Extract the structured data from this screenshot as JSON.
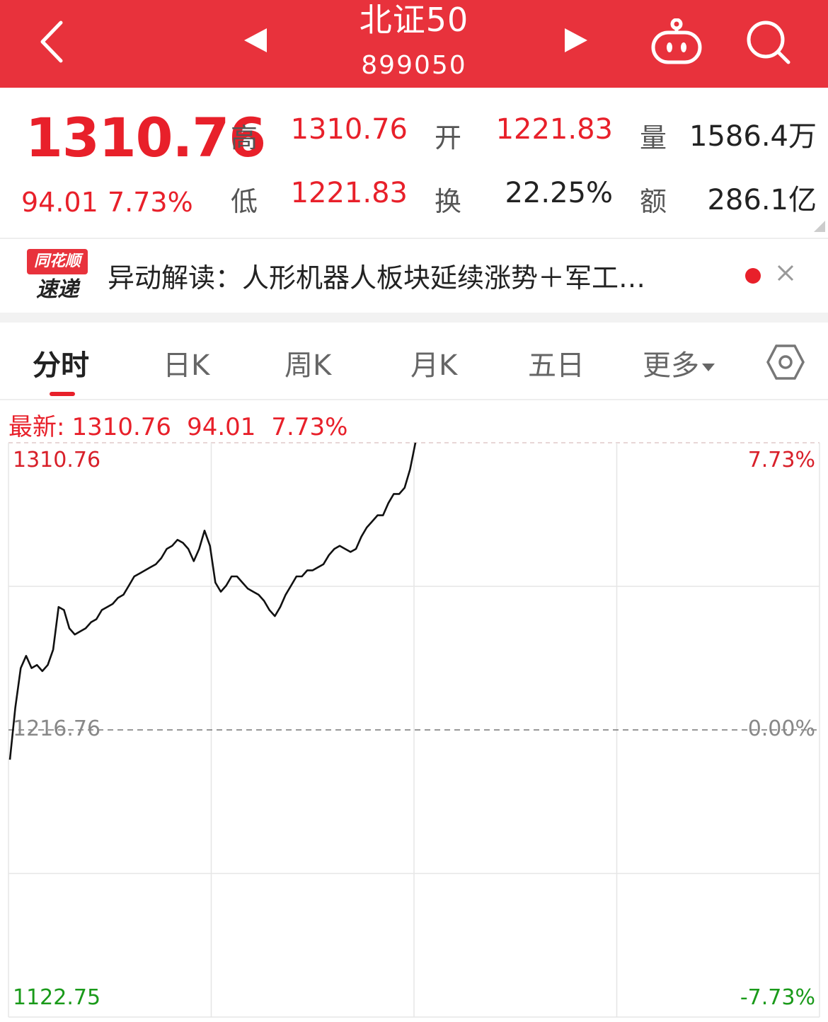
{
  "header": {
    "title": "北证50",
    "code": "899050",
    "icons": [
      "back-chevron-icon",
      "prev-triangle-icon",
      "next-triangle-icon",
      "robot-icon",
      "search-icon"
    ]
  },
  "quote": {
    "price": "1310.76",
    "change": "94.01",
    "change_pct": "7.73%",
    "high_label": "高",
    "high": "1310.76",
    "low_label": "低",
    "low": "1221.83",
    "open_label": "开",
    "open": "1221.83",
    "turnover_label": "换",
    "turnover": "22.25%",
    "volume_label": "量",
    "volume": "1586.4万",
    "amount_label": "额",
    "amount": "286.1亿"
  },
  "news": {
    "logo_top": "同花顺",
    "logo_bottom": "速递",
    "text": "异动解读：人形机器人板块延续涨势＋军工…"
  },
  "tabs": [
    {
      "label": "分时"
    },
    {
      "label": "日K"
    },
    {
      "label": "周K"
    },
    {
      "label": "月K"
    },
    {
      "label": "五日"
    },
    {
      "label": "更多"
    }
  ],
  "latest": {
    "label": "最新:",
    "price": "1310.76",
    "change": "94.01",
    "pct": "7.73%"
  },
  "colors": {
    "accent": "#e8323c",
    "up": "#e8202a",
    "down": "#1a9a1a"
  },
  "chart_data": {
    "type": "line",
    "y_max_label": "1310.76",
    "y_mid_label": "1216.76",
    "y_min_label": "1122.75",
    "pct_max_label": "7.73%",
    "pct_mid_label": "0.00%",
    "pct_min_label": "-7.73%",
    "ylim": [
      1122.75,
      1310.76
    ],
    "baseline": 1216.76,
    "x_range": [
      0,
      240
    ],
    "values": [
      1207,
      1224,
      1237,
      1241,
      1237,
      1238,
      1236,
      1238,
      1243,
      1257,
      1256,
      1250,
      1248,
      1249,
      1250,
      1252,
      1253,
      1256,
      1257,
      1258,
      1260,
      1261,
      1264,
      1267,
      1268,
      1269,
      1270,
      1271,
      1273,
      1276,
      1277,
      1279,
      1278,
      1276,
      1272,
      1276,
      1282,
      1277,
      1265,
      1262,
      1264,
      1267,
      1267,
      1265,
      1263,
      1262,
      1261,
      1259,
      1256,
      1254,
      1257,
      1261,
      1264,
      1267,
      1267,
      1269,
      1269,
      1270,
      1271,
      1274,
      1276,
      1277,
      1276,
      1275,
      1276,
      1280,
      1283,
      1285,
      1287,
      1287,
      1291,
      1294,
      1294,
      1296,
      1302,
      1310.76
    ]
  }
}
